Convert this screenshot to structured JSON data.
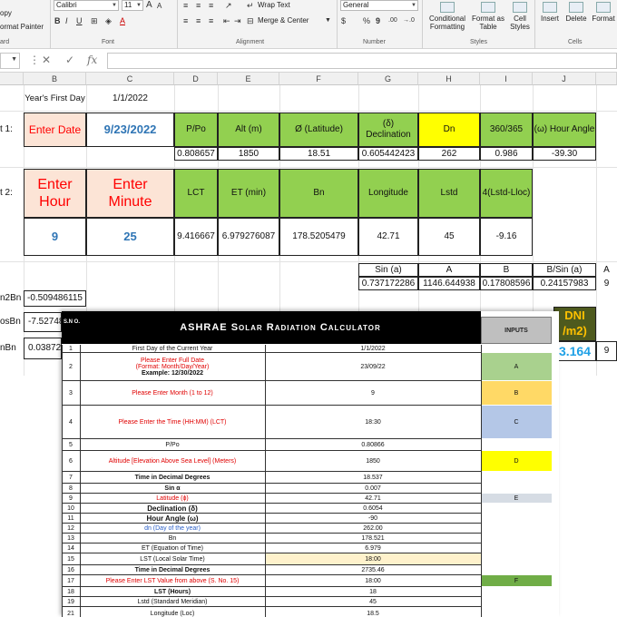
{
  "ribbon": {
    "copy": "opy",
    "format_painter": "ormat Painter",
    "clipboard_label": "ard",
    "font_name": "Calibri",
    "font_size": "11",
    "font_label": "Font",
    "wrap_text": "Wrap Text",
    "merge_center": "Merge & Center",
    "alignment_label": "Alignment",
    "number_format": "General",
    "number_label": "Number",
    "conditional_formatting": "Conditional Formatting",
    "format_as_table": "Format as Table",
    "cell_styles": "Cell Styles",
    "styles_label": "Styles",
    "insert": "Insert",
    "delete": "Delete",
    "format": "Format",
    "cells_label": "Cells",
    "bold": "B",
    "italic": "I",
    "underline": "U",
    "font_color": "A",
    "grow_font": "A",
    "shrink_font": "A",
    "currency": "$",
    "percent": "%",
    "comma": "9",
    "increase_decimal": ".00",
    "decrease_decimal": "→.0"
  },
  "formula_bar": {
    "fx": "fx"
  },
  "columns": [
    "B",
    "C",
    "D",
    "E",
    "F",
    "G",
    "H",
    "I",
    "J"
  ],
  "sheet": {
    "first_day_label": "Year's First Day",
    "first_day_value": "1/1/2022",
    "step1_label": "t 1:",
    "step2_label": "t 2:",
    "enter_date": "Enter Date",
    "date_value": "9/23/2022",
    "headers1": [
      "P/Po",
      "Alt (m)",
      "Ø (Latitude)",
      "(δ) Declination",
      "Dn",
      "360/365",
      "(ω) Hour Angle"
    ],
    "values1": [
      "0.808657",
      "1850",
      "18.51",
      "0.605442423",
      "262",
      "0.986",
      "-39.30"
    ],
    "enter_hour": "Enter Hour",
    "enter_minute": "Enter Minute",
    "hour_value": "9",
    "minute_value": "25",
    "headers2": [
      "LCT",
      "ET (min)",
      "Bn",
      "Longitude",
      "Lstd",
      "4(Lstd-Lloc)"
    ],
    "values2": [
      "9.416667",
      "6.979276087",
      "178.5205479",
      "42.71",
      "45",
      "-9.16"
    ],
    "headers3": [
      "Sin (a)",
      "A",
      "B",
      "B/Sin (a)"
    ],
    "values3": [
      "0.737172286",
      "1146.644938",
      "0.17808596",
      "0.24157983"
    ],
    "left_labels": [
      "n2Bn",
      "osBn",
      "nBn"
    ],
    "left_values": [
      "-0.509486115",
      "-7.52748",
      "0.03872"
    ],
    "dni_label": "DNI",
    "dni_unit": "/m2)",
    "dni_value": "3.164",
    "edge_9a": "9",
    "edge_9b": "9",
    "edge_A": "A"
  },
  "calculator": {
    "title": "ASHRAE Solar Radiation Calculator",
    "sn_header": "S.N O.",
    "inputs_header": "INPUTS",
    "rows": [
      {
        "sn": "1",
        "desc": "First Day of the Current Year",
        "value": "1/1/2022",
        "input": ""
      },
      {
        "sn": "2",
        "desc": "Please Enter Full Date",
        "desc2": "(Format: Month/Day/Year)",
        "desc3": "Example: 12/30/2022",
        "value": "23/09/22",
        "input": "A"
      },
      {
        "sn": "3",
        "desc": "Please Enter Month (1 to 12)",
        "value": "9",
        "input": "B"
      },
      {
        "sn": "4",
        "desc": "Please Enter the Time (HH:MM) (LCT)",
        "value": "18:30",
        "input": "C"
      },
      {
        "sn": "5",
        "desc": "P/Po",
        "value": "0.80866",
        "input": ""
      },
      {
        "sn": "6",
        "desc": "Altitude [Elevation Above Sea Level] (Meters)",
        "value": "1850",
        "input": "D"
      },
      {
        "sn": "7",
        "desc": "Time in Decimal Degrees",
        "value": "18.537",
        "input": ""
      },
      {
        "sn": "8",
        "desc": "Sin α",
        "value": "0.007",
        "input": ""
      },
      {
        "sn": "9",
        "desc": "Latitude (ϕ)",
        "value": "42.71",
        "input": "E"
      },
      {
        "sn": "10",
        "desc": "Declination (δ)",
        "value": "0.6054",
        "input": ""
      },
      {
        "sn": "11",
        "desc": "Hour Angle (ω)",
        "value": "-90",
        "input": ""
      },
      {
        "sn": "12",
        "desc": "dn (Day of the year)",
        "value": "262.00",
        "input": ""
      },
      {
        "sn": "13",
        "desc": "Bn",
        "value": "178.521",
        "input": ""
      },
      {
        "sn": "14",
        "desc": "ET (Equation of Time)",
        "value": "6.979",
        "input": ""
      },
      {
        "sn": "15",
        "desc": "LST (Local Solar Time)",
        "value": "18:00",
        "input": ""
      },
      {
        "sn": "16",
        "desc": "Time in Decimal Degrees",
        "value": "2735.46",
        "input": ""
      },
      {
        "sn": "17",
        "desc": "Please Enter LST Value from above (S. No. 15)",
        "value": "18:00",
        "input": "F"
      },
      {
        "sn": "18",
        "desc": "LST (Hours)",
        "value": "18",
        "input": ""
      },
      {
        "sn": "19",
        "desc": "Lstd (Standard Meridian)",
        "value": "45",
        "input": ""
      },
      {
        "sn": "21",
        "desc": "Longitude (Loc)",
        "value": "18.5",
        "input": ""
      }
    ]
  },
  "colors": {
    "green": "#92d050",
    "yellow": "#ffff00",
    "light_red": "#fce4d6",
    "red_text": "#ff0000",
    "blue_text": "#2f75b5",
    "input_a": "#a9d18e",
    "input_b": "#ffd966",
    "input_c": "#b4c7e7",
    "input_d": "#ffff00",
    "input_e": "#d6dce4",
    "input_f": "#70ad47"
  }
}
